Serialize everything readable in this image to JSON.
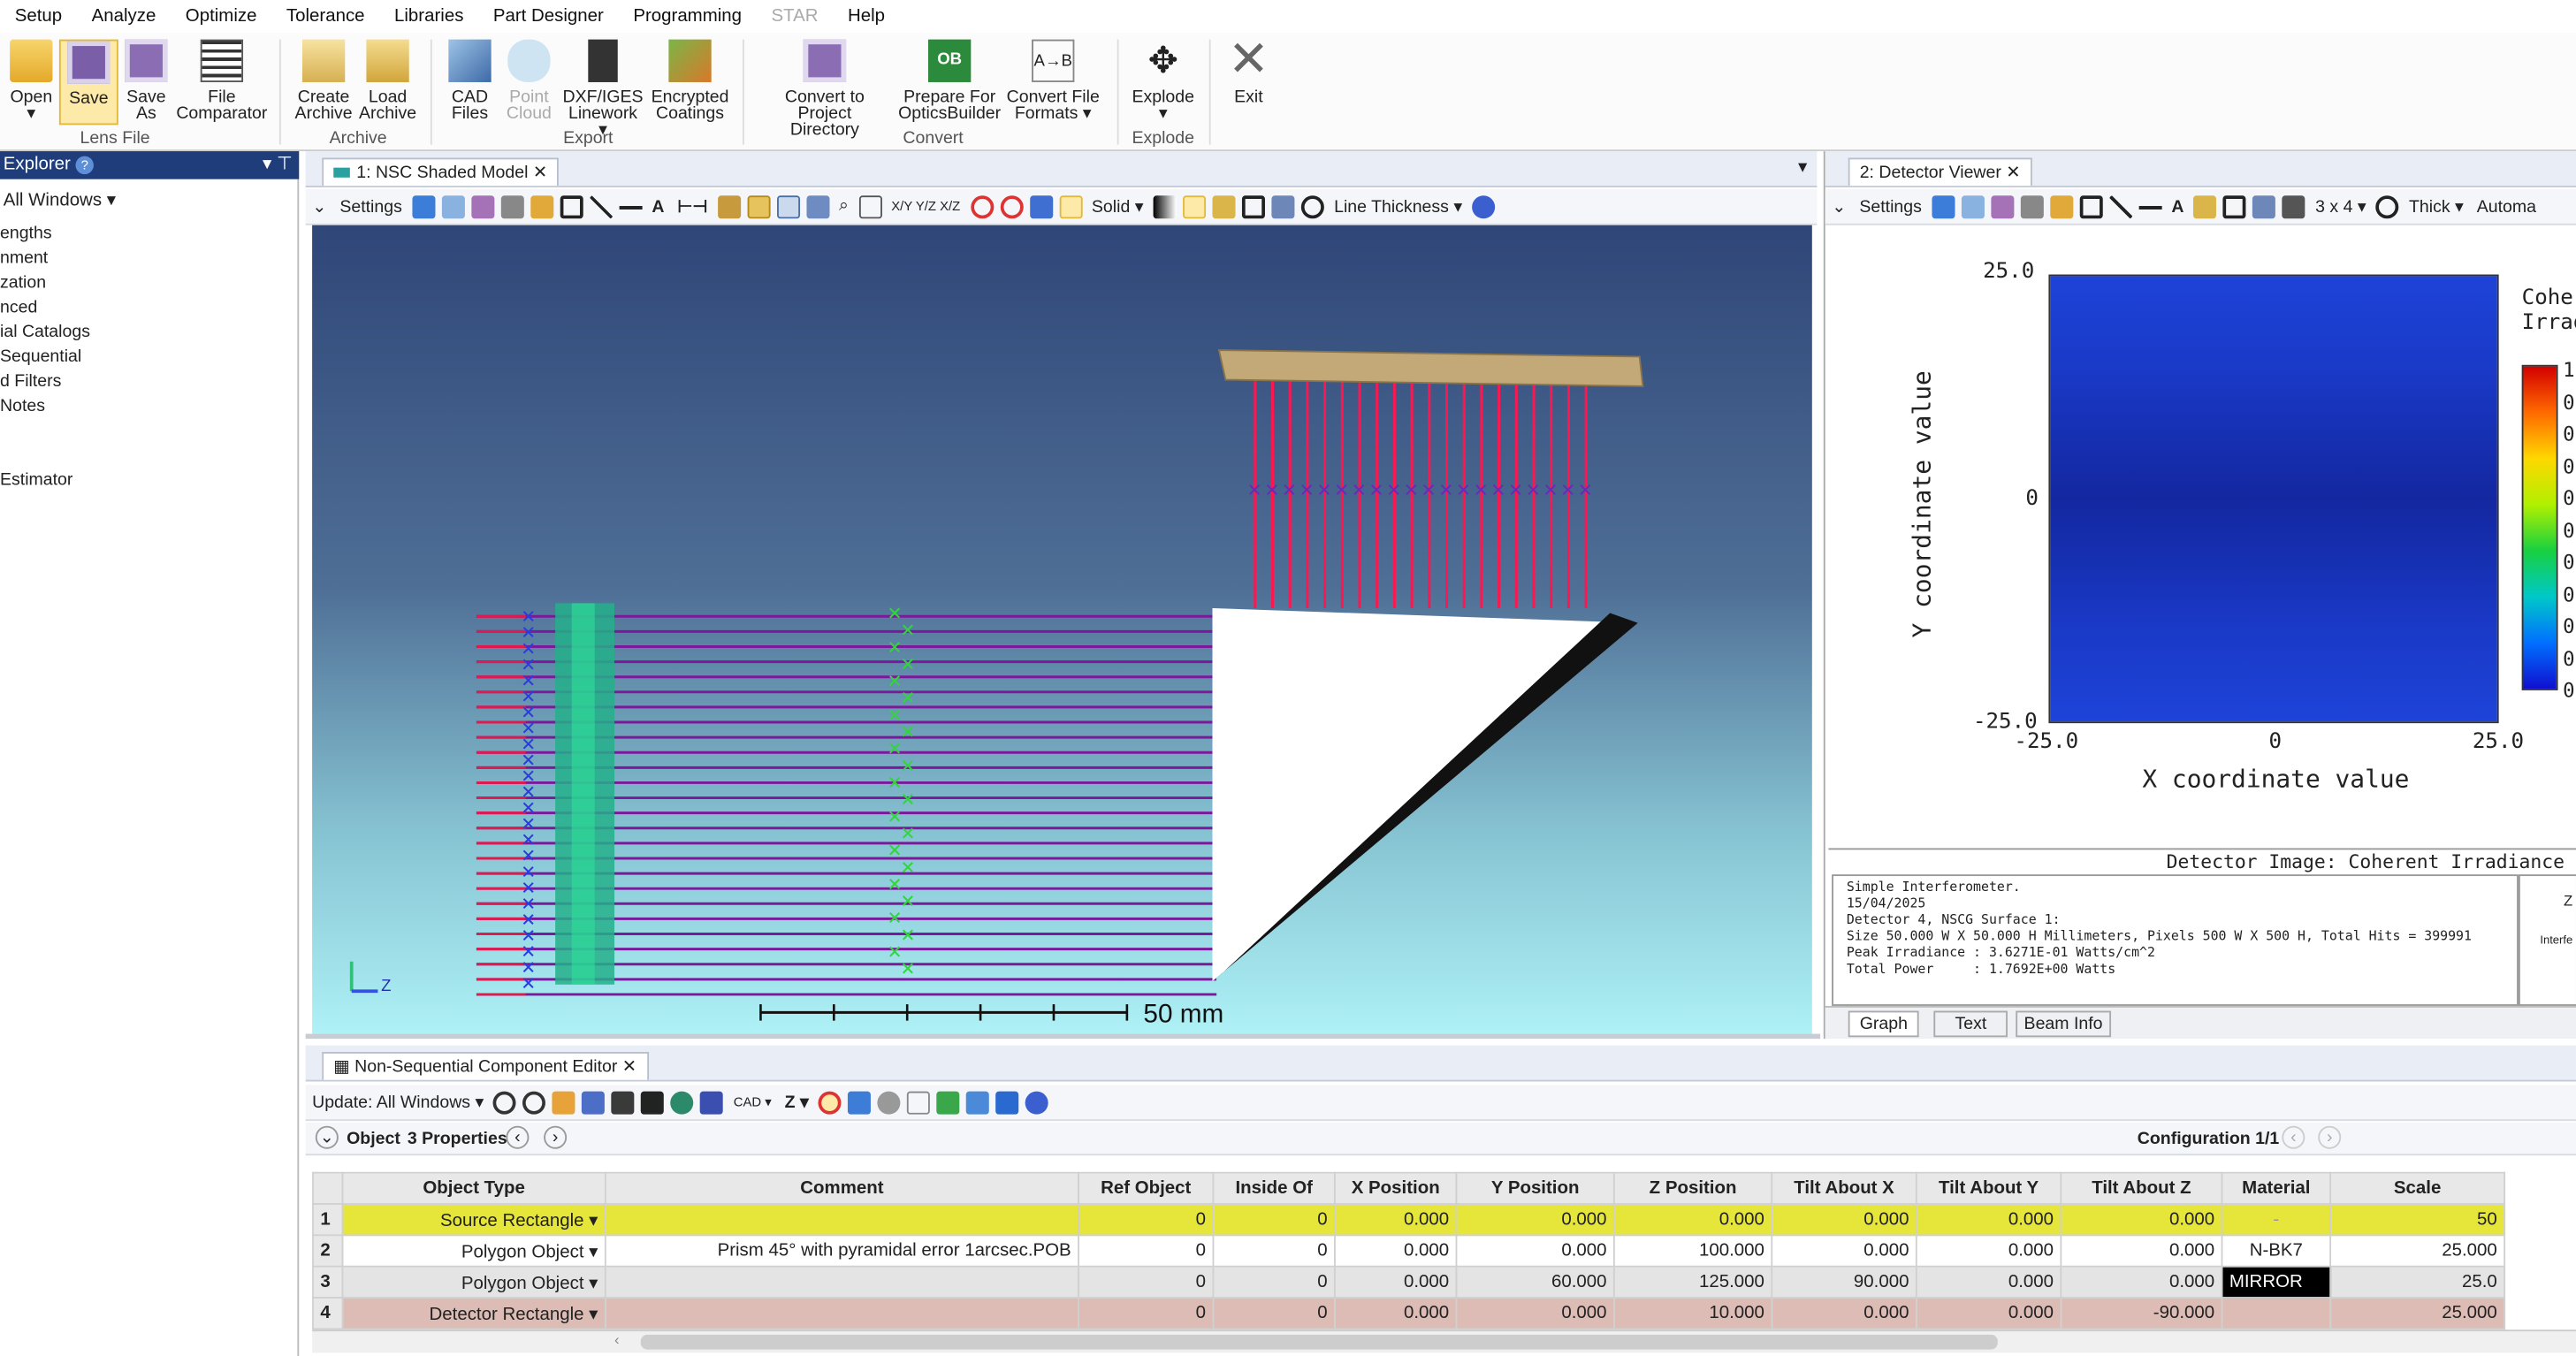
{
  "menu": [
    "Setup",
    "Analyze",
    "Optimize",
    "Tolerance",
    "Libraries",
    "Part Designer",
    "Programming",
    "STAR",
    "Help"
  ],
  "ribbon": {
    "buttons": [
      {
        "l1": "Open",
        "l2": "▾"
      },
      {
        "l1": "Save",
        "l2": ""
      },
      {
        "l1": "Save",
        "l2": "As"
      },
      {
        "l1": "File",
        "l2": "Comparator"
      },
      {
        "l1": "Create",
        "l2": "Archive"
      },
      {
        "l1": "Load",
        "l2": "Archive"
      },
      {
        "l1": "CAD",
        "l2": "Files"
      },
      {
        "l1": "Point",
        "l2": "Cloud"
      },
      {
        "l1": "DXF/IGES",
        "l2": "Linework ▾"
      },
      {
        "l1": "Encrypted",
        "l2": "Coatings"
      },
      {
        "l1": "Convert to Project",
        "l2": "Directory"
      },
      {
        "l1": "Prepare For",
        "l2": "OpticsBuilder"
      },
      {
        "l1": "Convert File",
        "l2": "Formats ▾"
      },
      {
        "l1": "Explode",
        "l2": "▾"
      },
      {
        "l1": "Exit",
        "l2": ""
      }
    ],
    "groups": [
      "Lens File",
      "Archive",
      "Export",
      "Convert",
      "Explode"
    ]
  },
  "left": {
    "title": "Explorer",
    "dropdown": "All Windows ▾",
    "items": [
      "engths",
      "nment",
      "zation",
      "nced",
      "ial Catalogs",
      "Sequential",
      "d Filters",
      "Notes",
      "Estimator"
    ]
  },
  "nsc": {
    "tab": "1: NSC Shaded Model",
    "settings": "Settings",
    "solid": "Solid ▾",
    "linethick": "Line Thickness ▾",
    "scale_label": "50 mm",
    "axis_z": "Z"
  },
  "det": {
    "tab": "2: Detector Viewer",
    "settings": "Settings",
    "grid": "3 x 4 ▾",
    "thick": "Thick ▾",
    "auto": "Automa",
    "ylabel": "Y coordinate value",
    "xlabel": "X coordinate value",
    "yticks": [
      "25.0",
      "0",
      "-25.0"
    ],
    "xticks": [
      "-25.0",
      "0",
      "25.0"
    ],
    "legend_title": [
      "Coher",
      "Irrad"
    ],
    "legend_ticks": [
      "1",
      "0",
      "0",
      "0",
      "0",
      "0",
      "0",
      "0",
      "0",
      "0",
      "0"
    ],
    "image_title": "Detector Image: Coherent Irradiance",
    "info": [
      "Simple Interferometer.",
      "15/04/2025",
      "Detector 4, NSCG Surface 1:",
      "Size 50.000 W X 50.000 H Millimeters, Pixels 500 W X 500 H, Total Hits = 399991",
      "Peak Irradiance : 3.6271E-01 Watts/cm^2",
      "Total Power     : 1.7692E+00 Watts"
    ],
    "side": [
      "Z",
      "Interfe"
    ],
    "tabs": [
      "Graph",
      "Text",
      "Beam Info"
    ]
  },
  "editor": {
    "tab": "Non-Sequential Component Editor",
    "update": "Update: All Windows ▾",
    "object": "Object",
    "props": "3 Properties",
    "config": "Configuration 1/1",
    "headers": [
      "",
      "Object Type",
      "Comment",
      "Ref Object",
      "Inside Of",
      "X Position",
      "Y Position",
      "Z Position",
      "Tilt About X",
      "Tilt About Y",
      "Tilt About Z",
      "Material",
      "Scale"
    ],
    "rows": [
      [
        "1",
        "Source Rectangle ▾",
        "",
        "0",
        "0",
        "0.000",
        "0.000",
        "0.000",
        "0.000",
        "0.000",
        "0.000",
        "-",
        "50"
      ],
      [
        "2",
        "Polygon Object ▾",
        "Prism 45° with pyramidal error 1arcsec.POB",
        "0",
        "0",
        "0.000",
        "0.000",
        "100.000",
        "0.000",
        "0.000",
        "0.000",
        "N-BK7",
        "25.000"
      ],
      [
        "3",
        "Polygon Object ▾",
        "",
        "0",
        "0",
        "0.000",
        "60.000",
        "125.000",
        "90.000",
        "0.000",
        "0.000",
        "MIRROR",
        "25.0"
      ],
      [
        "4",
        "Detector Rectangle ▾",
        "",
        "0",
        "0",
        "0.000",
        "0.000",
        "10.000",
        "0.000",
        "0.000",
        "-90.000",
        "",
        "25.000"
      ]
    ]
  }
}
